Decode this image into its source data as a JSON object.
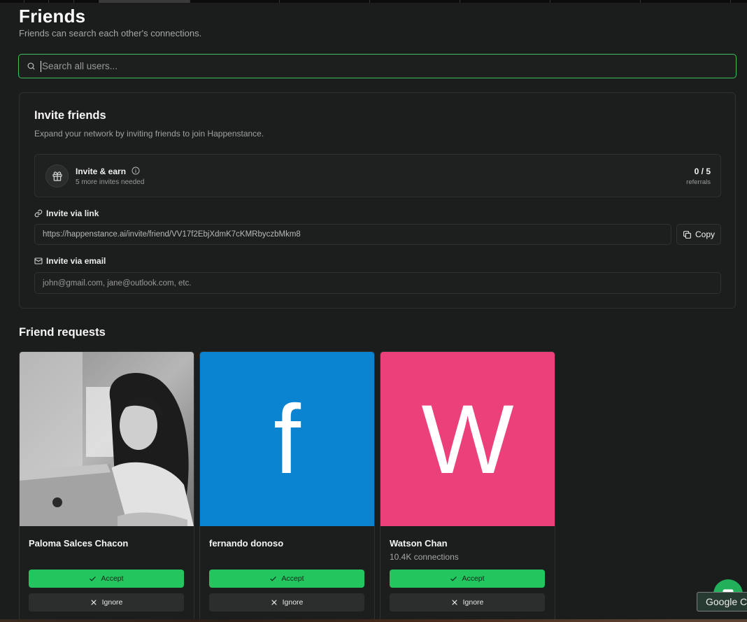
{
  "page": {
    "title": "Friends",
    "subtitle": "Friends can search each other's connections."
  },
  "search": {
    "placeholder": "Search all users...",
    "value": ""
  },
  "invite": {
    "title": "Invite friends",
    "description": "Expand your network by inviting friends to join Happenstance.",
    "earn": {
      "title": "Invite & earn",
      "subtitle": "5 more invites needed",
      "count": "0 / 5",
      "count_label": "referrals"
    },
    "link_section": {
      "label": "Invite via link",
      "url": "https://happenstance.ai/invite/friend/VV17f2EbjXdmK7cKMRbyczbMkm8",
      "copy_label": "Copy"
    },
    "email_section": {
      "label": "Invite via email",
      "placeholder": "john@gmail.com, jane@outlook.com, etc."
    }
  },
  "requests": {
    "title": "Friend requests",
    "items": [
      {
        "name": "Paloma Salces Chacon",
        "meta": "",
        "accept": "Accept",
        "ignore": "Ignore",
        "avatar": "photo"
      },
      {
        "name": "fernando donoso",
        "meta": "",
        "accept": "Accept",
        "ignore": "Ignore",
        "avatar": "f",
        "color": "#0a84d0"
      },
      {
        "name": "Watson Chan",
        "meta": "10.4K connections",
        "accept": "Accept",
        "ignore": "Ignore",
        "avatar": "W",
        "color": "#ec407a"
      }
    ]
  },
  "overlay": {
    "tooltip": "Google Chat",
    "chat_icon": "chat-bubble-icon"
  },
  "colors": {
    "accent": "#22c55e",
    "background": "#1b1c1c"
  }
}
